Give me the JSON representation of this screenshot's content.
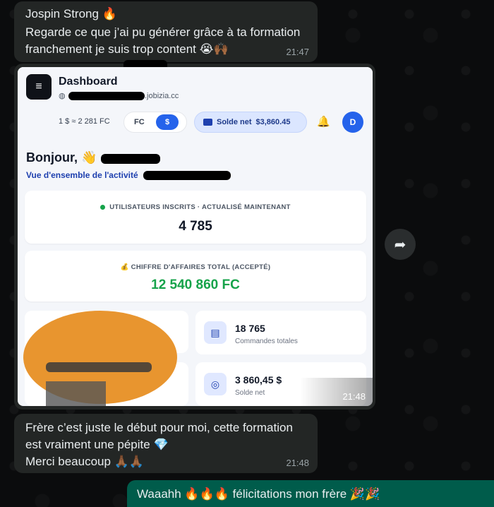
{
  "messages": [
    {
      "sender": "Jospin Strong 🔥",
      "text": "Regarde ce que j’ai pu générer grâce à ta formation\nfranchement je suis trop content 😭🙌🏾",
      "time": "21:47"
    },
    {
      "time": "21:48",
      "image": {
        "header": {
          "title": "Dashboard",
          "domain_suffix": ".jobizia.cc",
          "exchange_rate": "1 $ ≈ 2 281 FC",
          "currency_fc": "FC",
          "currency_usd": "$",
          "solde_label": "Solde net",
          "solde_value": "$3,860.45",
          "avatar_letter": "D"
        },
        "greeting": "Bonjour, 👋",
        "subtitle": "Vue d'ensemble de l'activité",
        "users_card": {
          "label": "UTILISATEURS INSCRITS · ACTUALISÉ MAINTENANT",
          "value": "4 785"
        },
        "revenue_card": {
          "label": "CHIFFRE D'AFFAIRES TOTAL (ACCEPTÉ)",
          "value": "12 540 860 FC"
        },
        "orders_card": {
          "value": "18 765",
          "label": "Commandes totales"
        },
        "net_card": {
          "value": "3 860,45 $",
          "label": "Solde net"
        }
      }
    },
    {
      "text": "Frère c’est juste le début pour moi, cette formation\nest vraiment une pépite 💎\nMerci beaucoup 🙏🏾🙏🏾",
      "time": "21:48"
    },
    {
      "text": "Waaahh 🔥🔥🔥 félicitations mon frère 🎉🎉"
    }
  ],
  "colors": {
    "chat_bg": "#0b0c0d",
    "incoming_bubble": "#232625",
    "outgoing_bubble": "#005c4b",
    "accent_blue": "#2563eb",
    "revenue_green": "#16a34a",
    "redaction_orange": "#e8952f"
  },
  "icons": {
    "forward": "forward-arrow-icon",
    "menu": "menu-icon",
    "bell": "bell-icon",
    "wallet": "wallet-icon",
    "globe": "globe-icon",
    "receipt": "receipt-icon",
    "coins": "coins-icon"
  }
}
